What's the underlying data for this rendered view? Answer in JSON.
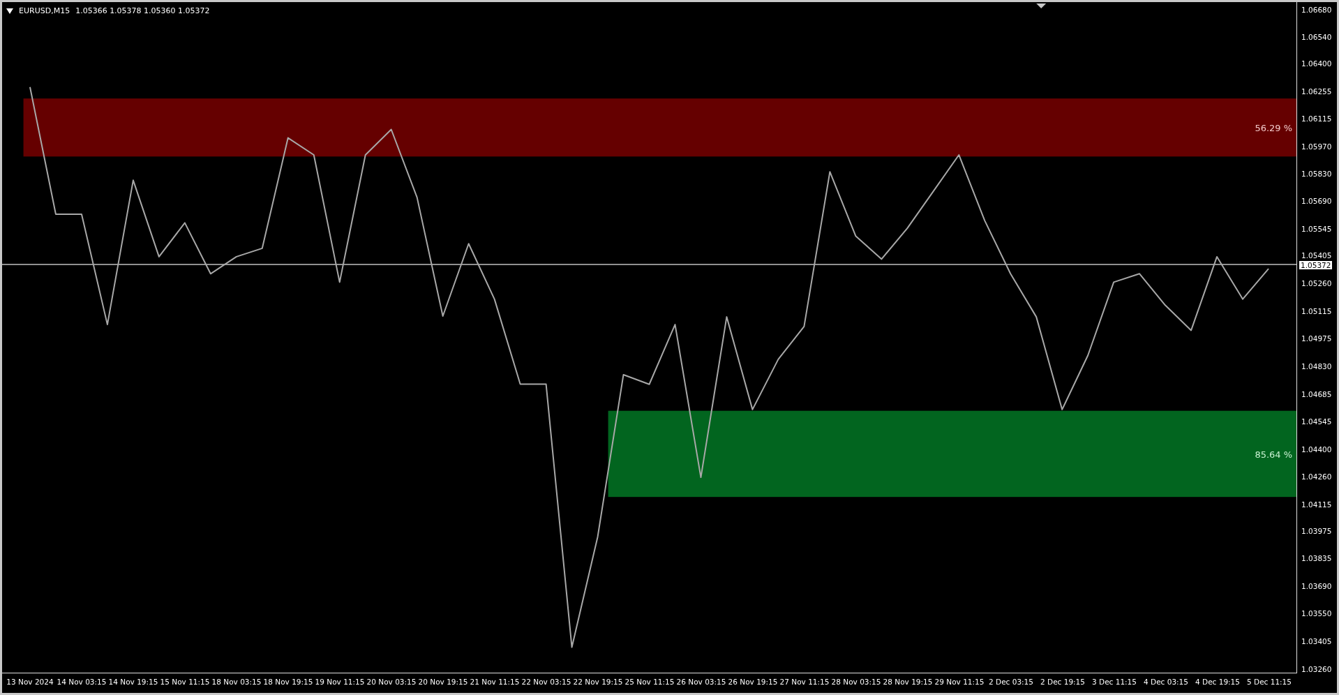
{
  "chart_header": {
    "symbol": "EURUSD,M15",
    "quote": "1.05366 1.05378 1.05360 1.05372"
  },
  "zones": [
    {
      "kind": "supply",
      "label": "56.29 %",
      "color": "#650000"
    },
    {
      "kind": "demand",
      "label": "85.64 %",
      "color": "#02651f"
    }
  ],
  "chart_data": {
    "type": "line",
    "ylim": [
      1.03253,
      1.06734
    ],
    "ref_lines": [
      {
        "axis": "y",
        "value": 1.05372,
        "label": "1.05372"
      }
    ],
    "categories": [
      "13 Nov 2024",
      null,
      "14 Nov 03:15",
      null,
      "14 Nov 19:15",
      null,
      "15 Nov 11:15",
      null,
      "18 Nov 03:15",
      null,
      "18 Nov 19:15",
      null,
      "19 Nov 11:15",
      null,
      "20 Nov 03:15",
      null,
      "20 Nov 19:15",
      null,
      "21 Nov 11:15",
      null,
      "22 Nov 03:15",
      null,
      "22 Nov 19:15",
      null,
      "25 Nov 11:15",
      null,
      "26 Nov 03:15",
      null,
      "26 Nov 19:15",
      null,
      "27 Nov 11:15",
      null,
      "28 Nov 03:15",
      null,
      "28 Nov 19:15",
      null,
      "29 Nov 11:15",
      null,
      "2 Dec 03:15",
      null,
      "2 Dec 19:15",
      null,
      "3 Dec 11:15",
      null,
      "4 Dec 03:15",
      null,
      "4 Dec 19:15",
      null,
      "5 Dec 11:15"
    ],
    "series": [
      {
        "color": "#a8a8a8",
        "values": [
          1.06293,
          1.05633,
          1.05633,
          1.0506,
          1.05809,
          1.05412,
          1.05588,
          1.05324,
          1.05412,
          1.05456,
          1.06029,
          1.05941,
          1.0528,
          1.05941,
          1.06073,
          1.0572,
          1.05104,
          1.0548,
          1.05192,
          1.04751,
          1.04751,
          1.03385,
          1.03958,
          1.048,
          1.0475,
          1.0506,
          1.04267,
          1.051,
          1.04619,
          1.0488,
          1.0505,
          1.05853,
          1.0552,
          1.054,
          1.0556,
          1.0575,
          1.05941,
          1.056,
          1.05324,
          1.051,
          1.04619,
          1.049,
          1.0528,
          1.05324,
          1.0516,
          1.0503,
          1.05412,
          1.05192,
          1.0535
        ]
      }
    ],
    "yticks": [
      {
        "value": 1.0668,
        "label": "1.06680"
      },
      {
        "value": 1.0654,
        "label": "1.06540"
      },
      {
        "value": 1.064,
        "label": "1.06400"
      },
      {
        "value": 1.06255,
        "label": "1.06255"
      },
      {
        "value": 1.06115,
        "label": "1.06115"
      },
      {
        "value": 1.0597,
        "label": "1.05970"
      },
      {
        "value": 1.0583,
        "label": "1.05830"
      },
      {
        "value": 1.0569,
        "label": "1.05690"
      },
      {
        "value": 1.05545,
        "label": "1.05545"
      },
      {
        "value": 1.05405,
        "label": "1.05405"
      },
      {
        "value": 1.0526,
        "label": "1.05260"
      },
      {
        "value": 1.05115,
        "label": "1.05115"
      },
      {
        "value": 1.04975,
        "label": "1.04975"
      },
      {
        "value": 1.0483,
        "label": "1.04830"
      },
      {
        "value": 1.04685,
        "label": "1.04685"
      },
      {
        "value": 1.04545,
        "label": "1.04545"
      },
      {
        "value": 1.044,
        "label": "1.04400"
      },
      {
        "value": 1.0426,
        "label": "1.04260"
      },
      {
        "value": 1.04115,
        "label": "1.04115"
      },
      {
        "value": 1.03975,
        "label": "1.03975"
      },
      {
        "value": 1.03835,
        "label": "1.03835"
      },
      {
        "value": 1.0369,
        "label": "1.03690"
      },
      {
        "value": 1.0355,
        "label": "1.03550"
      },
      {
        "value": 1.03405,
        "label": "1.03405"
      },
      {
        "value": 1.0326,
        "label": "1.03260"
      }
    ]
  }
}
